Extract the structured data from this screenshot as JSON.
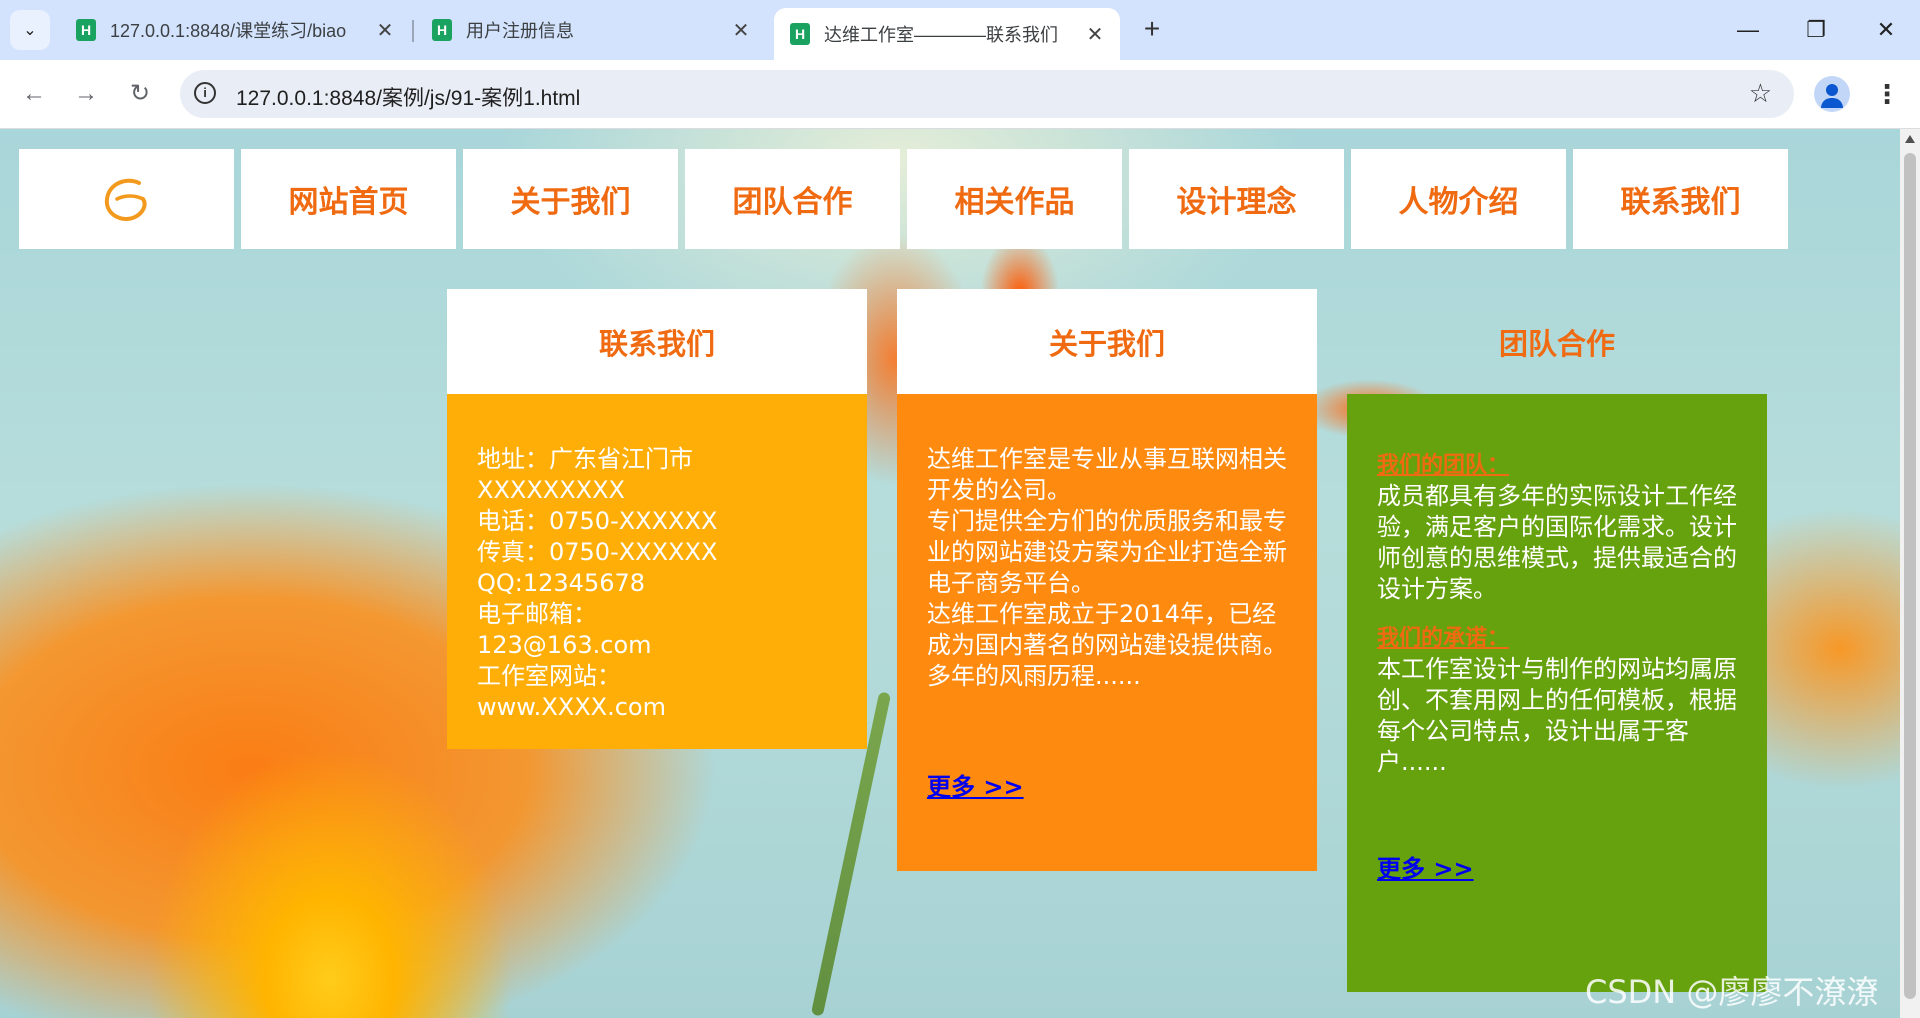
{
  "browser": {
    "tabs": [
      {
        "title": "127.0.0.1:8848/课堂练习/biao",
        "favicon": "H",
        "active": false
      },
      {
        "title": "用户注册信息",
        "favicon": "H",
        "active": false
      },
      {
        "title": "达维工作室————联系我们",
        "favicon": "H",
        "active": true
      }
    ],
    "new_tab_label": "+",
    "url": "127.0.0.1:8848/案例/js/91-案例1.html"
  },
  "page": {
    "nav": {
      "logo_icon": "swirl-logo-icon",
      "items": [
        "网站首页",
        "关于我们",
        "团队合作",
        "相关作品",
        "设计理念",
        "人物介绍",
        "联系我们"
      ]
    },
    "contact": {
      "title": "联系我们",
      "lines": [
        "地址：广东省江门市XXXXXXXXX",
        "电话：0750-XXXXXX",
        "传真：0750-XXXXXX",
        "QQ:12345678",
        "电子邮箱：",
        "123@163.com",
        "工作室网站：",
        "www.XXXX.com"
      ]
    },
    "about": {
      "title": "关于我们",
      "paragraphs": [
        "达维工作室是专业从事互联网相关开发的公司。",
        "专门提供全方们的优质服务和最专业的网站建设方案为企业打造全新电子商务平台。",
        "达维工作室成立于2014年，已经成为国内著名的网站建设提供商。多年的风雨历程......"
      ],
      "more": "更多 >>"
    },
    "team": {
      "title": "团队合作",
      "team_heading": "我们的团队：",
      "team_text": "成员都具有多年的实际设计工作经验，满足客户的国际化需求。设计师创意的思维模式，提供最适合的设计方案。",
      "promise_heading": "我们的承诺：",
      "promise_text": "本工作室设计与制作的网站均属原创、不套用网上的任何模板，根据每个公司特点，设计出属于客户......",
      "more": "更多 >>"
    },
    "watermark": "CSDN @廖廖不潦潦"
  },
  "colors": {
    "accent": "#ef6a10",
    "contact_bg": "#ffae08",
    "about_bg": "#ff8a10",
    "team_bg": "#66a20e",
    "link": "#0000ee"
  }
}
